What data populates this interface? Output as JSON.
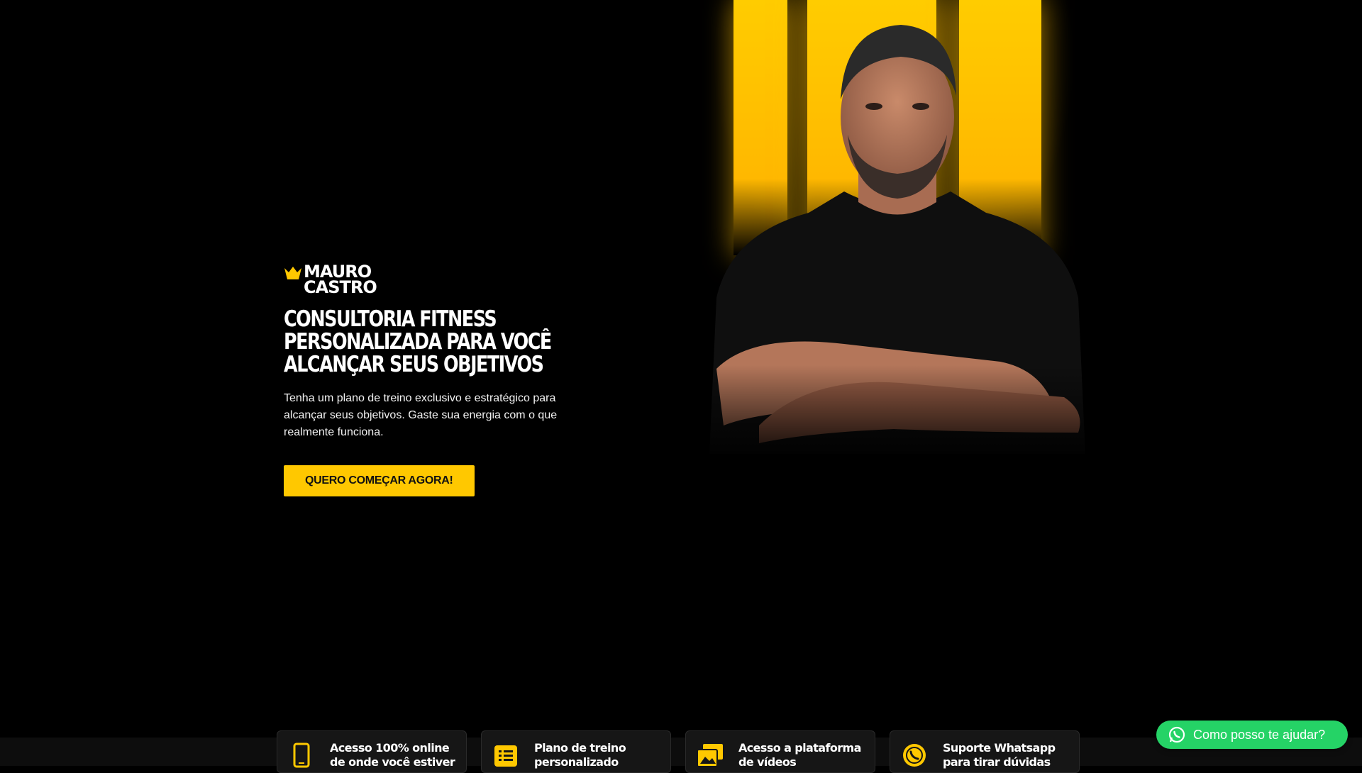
{
  "brand": {
    "logo_line1": "MAURO",
    "logo_line2": "CASTRO"
  },
  "hero": {
    "headline": "CONSULTORIA FITNESS PERSONALIZADA PARA VOCÊ ALCANÇAR SEUS OBJETIVOS",
    "subtext": "Tenha um plano de treino exclusivo e estratégico para alcançar seus objetivos. Gaste sua energia com o que realmente funciona.",
    "cta_label": "QUERO COMEÇAR AGORA!"
  },
  "features": [
    {
      "icon": "phone-icon",
      "label": "Acesso 100% online de onde você estiver"
    },
    {
      "icon": "list-icon",
      "label": "Plano de treino personalizado"
    },
    {
      "icon": "video-library-icon",
      "label": "Acesso a plataforma de vídeos"
    },
    {
      "icon": "whatsapp-icon",
      "label": "Suporte Whatsapp para tirar dúvidas"
    }
  ],
  "whatsapp_widget": {
    "label": "Como posso te ajudar?"
  },
  "colors": {
    "accent": "#ffc800",
    "background": "#000000",
    "whatsapp": "#25d366"
  }
}
